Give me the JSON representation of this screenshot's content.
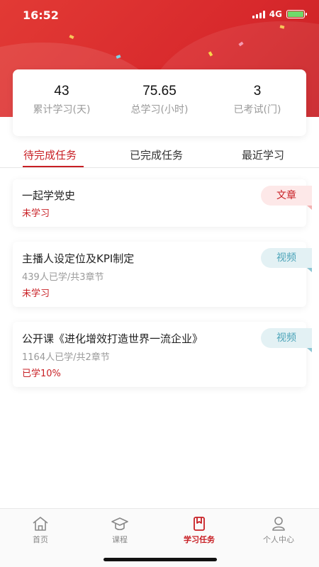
{
  "status_bar": {
    "time": "16:52",
    "network": "4G"
  },
  "stats": [
    {
      "value": "43",
      "label": "累计学习(天)"
    },
    {
      "value": "75.65",
      "label": "总学习(小时)"
    },
    {
      "value": "3",
      "label": "已考试(门)"
    }
  ],
  "tabs": [
    {
      "label": "待完成任务",
      "active": true
    },
    {
      "label": "已完成任务",
      "active": false
    },
    {
      "label": "最近学习",
      "active": false
    }
  ],
  "tasks": [
    {
      "title": "一起学党史",
      "meta": "",
      "status": "未学习",
      "badge": "文章"
    },
    {
      "title": "主播人设定位及KPI制定",
      "meta": "439人已学/共3章节",
      "status": "未学习",
      "badge": "视频"
    },
    {
      "title": "公开课《进化增效打造世界一流企业》",
      "meta": "1164人已学/共2章节",
      "status": "已学10%",
      "badge": "视频"
    }
  ],
  "bottom_nav": [
    {
      "label": "首页",
      "icon": "home-icon",
      "active": false
    },
    {
      "label": "课程",
      "icon": "graduation-cap-icon",
      "active": false
    },
    {
      "label": "学习任务",
      "icon": "bookmark-icon",
      "active": true
    },
    {
      "label": "个人中心",
      "icon": "user-icon",
      "active": false
    }
  ],
  "colors": {
    "brand_red": "#c81f24",
    "video_teal": "#4aa3b8",
    "article_pink_bg": "#fde8e8"
  }
}
